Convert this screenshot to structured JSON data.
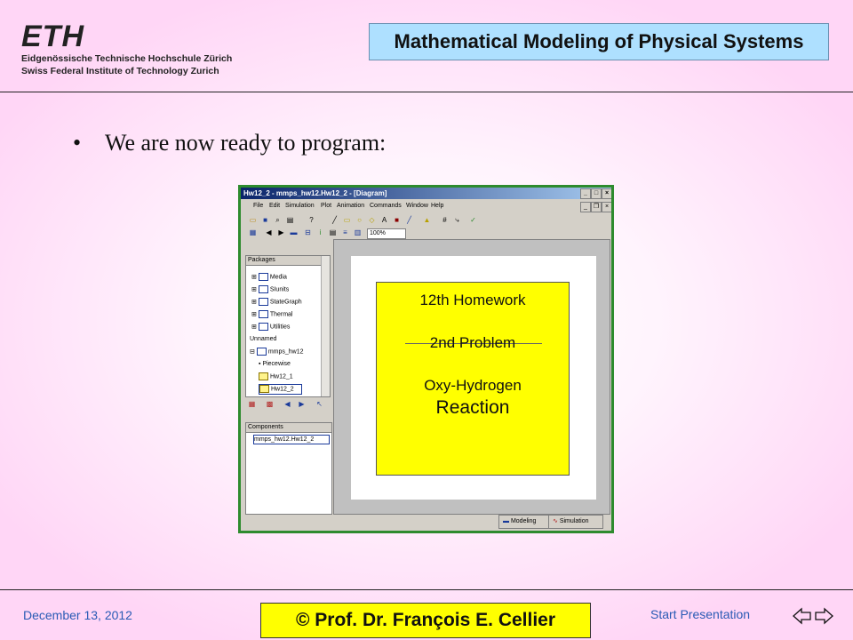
{
  "header": {
    "logo": "ETH",
    "institution_de": "Eidgenössische Technische Hochschule Zürich",
    "institution_en": "Swiss Federal Institute of Technology Zurich",
    "course_title": "Mathematical Modeling of Physical Systems"
  },
  "slide": {
    "bullet": "•",
    "text": "We are now ready to program:"
  },
  "app": {
    "window_title": "Hw12_2 - mmps_hw12.Hw12_2 - [Diagram]",
    "menus": [
      "File",
      "Edit",
      "Simulation",
      "Plot",
      "Animation",
      "Commands",
      "Window",
      "Help"
    ],
    "zoom": "100%",
    "packages_header": "Packages",
    "tree": [
      "Media",
      "SIunits",
      "StateGraph",
      "Thermal",
      "Utilities",
      "Unnamed",
      "mmps_hw12",
      "Piecewise",
      "Hw12_1",
      "Hw12_2"
    ],
    "components_header": "Components",
    "component_item": "mmps_hw12.Hw12_2",
    "diagram": {
      "line1": "12th Homework",
      "line2": "2nd Problem",
      "line3": "Oxy-Hydrogen",
      "line4": "Reaction"
    },
    "tabs": {
      "modeling": "Modeling",
      "simulation": "Simulation"
    }
  },
  "footer": {
    "date": "December 13, 2012",
    "author": "©  Prof. Dr. François E. Cellier",
    "start": "Start Presentation"
  },
  "colors": {
    "title_box": "#aee0ff",
    "author_box": "#ffff00",
    "diagram_box": "#ffff00",
    "window_border": "#2e8b2e",
    "footer_text": "#2a5bb5"
  }
}
